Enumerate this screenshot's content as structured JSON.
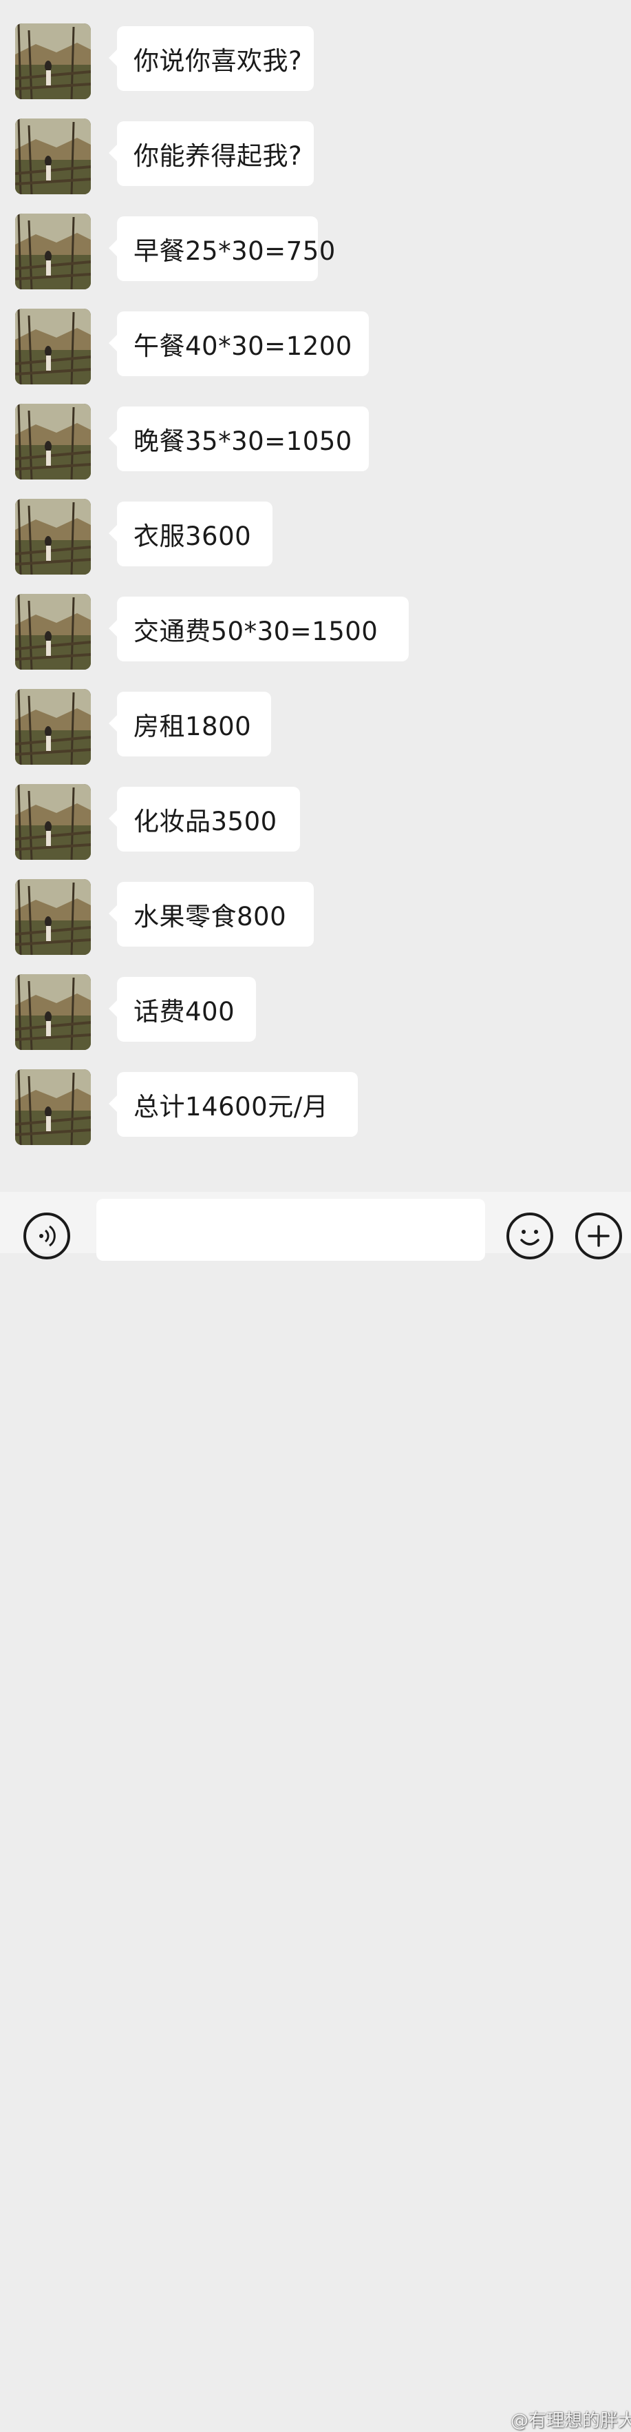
{
  "messages": [
    {
      "text": "你说你喜欢我?"
    },
    {
      "text": "你能养得起我?"
    },
    {
      "text": "早餐25*30=750"
    },
    {
      "text": "午餐40*30=1200"
    },
    {
      "text": "晚餐35*30=1050"
    },
    {
      "text": "衣服3600"
    },
    {
      "text": "交通费50*30=1500"
    },
    {
      "text": "房租1800"
    },
    {
      "text": "化妆品3500"
    },
    {
      "text": "水果零食800"
    },
    {
      "text": "话费400"
    },
    {
      "text": "总计14600元/月"
    }
  ],
  "input_bar": {
    "voice_icon": "voice-icon",
    "emoji_icon": "emoji-icon",
    "plus_icon": "plus-icon"
  },
  "watermark": {
    "text": "@有理想的胖大"
  },
  "colors": {
    "background": "#ededed",
    "bubble": "#ffffff",
    "text": "#1a1a1a"
  }
}
